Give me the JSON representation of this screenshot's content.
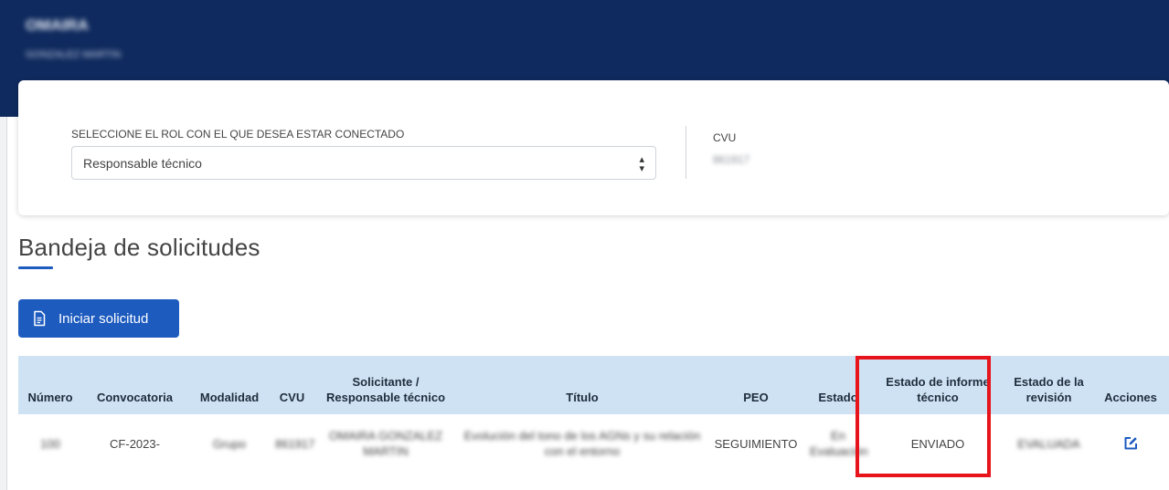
{
  "header": {
    "user_name": "OMAIRA",
    "user_subtitle": "GONZALEZ MARTIN"
  },
  "role_selector": {
    "label": "SELECCIONE EL ROL CON EL QUE DESEA ESTAR CONECTADO",
    "selected": "Responsable técnico"
  },
  "cvu": {
    "label": "CVU",
    "value": "861917"
  },
  "page": {
    "title": "Bandeja de solicitudes",
    "start_button": "Iniciar solicitud"
  },
  "table": {
    "columns": [
      "Número",
      "Convocatoria",
      "Modalidad",
      "CVU",
      "Solicitante / Responsable técnico",
      "Título",
      "PEO",
      "Estado",
      "Estado de informe técnico",
      "Estado de la revisión",
      "Acciones"
    ],
    "rows": [
      {
        "numero": "100",
        "convocatoria": "CF-2023-",
        "modalidad": "Grupo",
        "cvu": "861917",
        "solicitante": "OMAIRA GONZALEZ MARTIN",
        "titulo": "Evolución del tono de los AGNs y su relación con el entorno",
        "peo": "SEGUIMIENTO",
        "estado": "En Evaluación",
        "estado_informe": "ENVIADO",
        "estado_revision": "EVALUADA",
        "accion_icon": "edit-icon"
      }
    ]
  },
  "colors": {
    "header_bg": "#0f2a5e",
    "accent": "#1d5bbf",
    "table_header_bg": "#cfe2f3",
    "highlight": "#e8141b"
  }
}
